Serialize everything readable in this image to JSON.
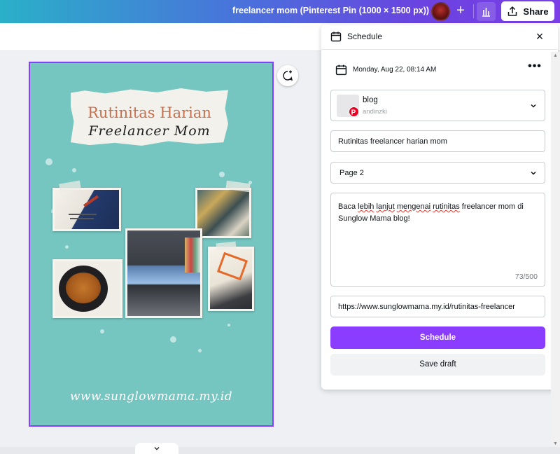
{
  "header": {
    "doc_title": "freelancer mom (Pinterest Pin (1000 × 1500 px))",
    "plus": "+",
    "share_label": "Share"
  },
  "pin": {
    "title_line1": "Rutinitas Harian",
    "title_line2": "Freelancer Mom",
    "url": "www.sunglowmama.my.id",
    "background_color": "#76c6c1",
    "title_color": "#c8704e"
  },
  "panel": {
    "title": "Schedule",
    "close": "×",
    "date": "Monday, Aug 22, 08:14 AM",
    "more": "•••",
    "account": {
      "board": "blog",
      "username": "andinzki",
      "platform_icon": "pinterest-icon"
    },
    "pin_title": "Rutinitas freelancer harian mom",
    "page_select": "Page 2",
    "description": {
      "before1": "Baca ",
      "w1": "lebih",
      "sp1": " ",
      "w2": "lanjut",
      "sp2": " ",
      "w3": "mengenai",
      "sp3": " ",
      "w4": "rutinitas",
      "after": " freelancer mom di Sunglow Mama blog!",
      "count": "73/500"
    },
    "link": "https://www.sunglowmama.my.id/rutinitas-freelancer",
    "schedule_label": "Schedule",
    "draft_label": "Save draft",
    "accent_color": "#8b3dff"
  }
}
